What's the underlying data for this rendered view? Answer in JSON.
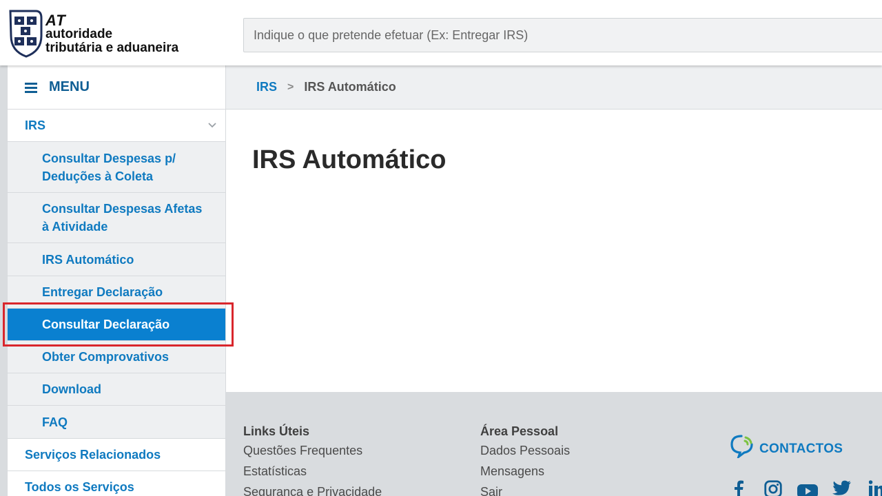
{
  "header": {
    "logo": {
      "at": "AT",
      "line1": "autoridade",
      "line2": "tributária e aduaneira"
    },
    "search_placeholder": "Indique o que pretende efetuar (Ex: Entregar IRS)"
  },
  "sidebar": {
    "menu_label": "MENU",
    "section": "IRS",
    "items": [
      "Consultar Despesas p/ Deduções à Coleta",
      "Consultar Despesas Afetas à Atividade",
      "IRS Automático",
      "Entregar Declaração",
      "Consultar Declaração",
      "Obter Comprovativos",
      "Download",
      "FAQ"
    ],
    "active_item": "Consultar Declaração",
    "related": [
      "Serviços Relacionados",
      "Todos os Serviços"
    ]
  },
  "breadcrumb": {
    "link": "IRS",
    "separator": ">",
    "current": "IRS Automático"
  },
  "main": {
    "title": "IRS Automático"
  },
  "footer": {
    "links_title": "Links Úteis",
    "links": [
      "Questões Frequentes",
      "Estatísticas",
      "Segurança e Privacidade"
    ],
    "personal_title": "Área Pessoal",
    "personal": [
      "Dados Pessoais",
      "Mensagens",
      "Sair"
    ],
    "contacts_label": "CONTACTOS",
    "socials": [
      "facebook-icon",
      "instagram-icon",
      "youtube-icon",
      "twitter-icon",
      "linkedin-icon"
    ]
  },
  "colors": {
    "brand_blue": "#0f7ac0",
    "active_bg": "#0a80d0",
    "highlight_red": "#d9262c",
    "contacts_green": "#7cc242"
  }
}
